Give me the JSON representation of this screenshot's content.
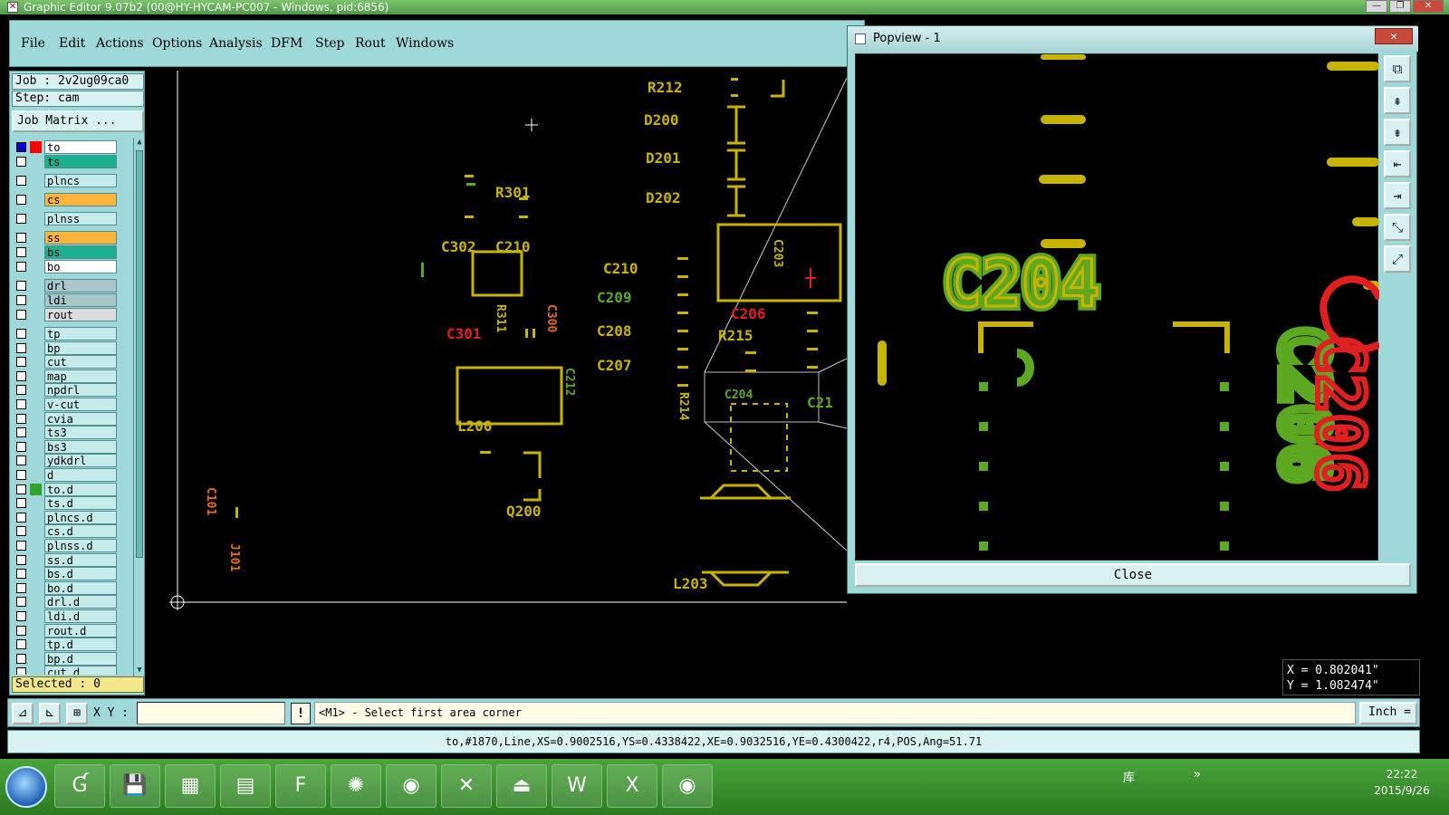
{
  "window": {
    "title": "Graphic Editor 9.07b2 (00@HY-HYCAM-PC007 - Windows, pid:6856)",
    "minimize": "—",
    "restore": "❐",
    "close": "✕"
  },
  "menu": [
    "File",
    "Edit",
    "Actions",
    "Options",
    "Analysis",
    "DFM",
    "Step",
    "Rout",
    "Windows"
  ],
  "job": {
    "job_text": "Job : 2v2ug09ca0",
    "step_text": "Step: cam",
    "matrix_button": "Job Matrix ..."
  },
  "layers": [
    {
      "name": "to",
      "color": "#ffffff",
      "active": true,
      "indicator": "#ff0000"
    },
    {
      "name": "ts",
      "color": "#1db08f"
    },
    {
      "name": "plncs",
      "color": "#c6ebeb"
    },
    {
      "name": "cs",
      "color": "#ffb43c"
    },
    {
      "name": "plnss",
      "color": "#c6ebeb"
    },
    {
      "name": "ss",
      "color": "#ffb43c"
    },
    {
      "name": "bs",
      "color": "#1db08f"
    },
    {
      "name": "bo",
      "color": "#ffffff"
    },
    {
      "name": "drl",
      "color": "#a9c6c9"
    },
    {
      "name": "ldi",
      "color": "#a9c6c9"
    },
    {
      "name": "rout",
      "color": "#dcdcdc"
    },
    {
      "name": "tp",
      "color": "#c6ebeb"
    },
    {
      "name": "bp",
      "color": "#c6ebeb"
    },
    {
      "name": "cut",
      "color": "#c6ebeb"
    },
    {
      "name": "map",
      "color": "#c6ebeb"
    },
    {
      "name": "npdrl",
      "color": "#c6ebeb"
    },
    {
      "name": "v-cut",
      "color": "#c6ebeb"
    },
    {
      "name": "cvia",
      "color": "#c6ebeb"
    },
    {
      "name": "ts3",
      "color": "#c6ebeb"
    },
    {
      "name": "bs3",
      "color": "#c6ebeb"
    },
    {
      "name": "ydkdrl",
      "color": "#c6ebeb"
    },
    {
      "name": "d",
      "color": "#c6ebeb"
    },
    {
      "name": "to.d",
      "color": "#c6ebeb",
      "indicator": "#2fa52f"
    },
    {
      "name": "ts.d",
      "color": "#c6ebeb"
    },
    {
      "name": "plncs.d",
      "color": "#c6ebeb"
    },
    {
      "name": "cs.d",
      "color": "#c6ebeb"
    },
    {
      "name": "plnss.d",
      "color": "#c6ebeb"
    },
    {
      "name": "ss.d",
      "color": "#c6ebeb"
    },
    {
      "name": "bs.d",
      "color": "#c6ebeb"
    },
    {
      "name": "bo.d",
      "color": "#c6ebeb"
    },
    {
      "name": "drl.d",
      "color": "#c6ebeb"
    },
    {
      "name": "ldi.d",
      "color": "#c6ebeb"
    },
    {
      "name": "rout.d",
      "color": "#c6ebeb"
    },
    {
      "name": "tp.d",
      "color": "#c6ebeb"
    },
    {
      "name": "bp.d",
      "color": "#c6ebeb"
    },
    {
      "name": "cut.d",
      "color": "#c6ebeb"
    }
  ],
  "selected_text": "Selected : 0",
  "canvas": {
    "labels": [
      "R212",
      "D200",
      "D201",
      "D202",
      "R301",
      "C302",
      "C210",
      "C210",
      "C209",
      "C208",
      "C207",
      "C301",
      "R311",
      "C300",
      "C212",
      "L200",
      "C203",
      "C206",
      "R215",
      "C204",
      "R214",
      "C21",
      "Q200",
      "L203",
      "C101",
      "J101"
    ]
  },
  "popview": {
    "title": "Popview - 1",
    "close_x": "✕",
    "close_button": "Close",
    "tools": [
      "zoom-fit",
      "page-up",
      "page-down",
      "page-left",
      "page-right",
      "zoom-out",
      "zoom-in"
    ],
    "labels": [
      "C204",
      "C206"
    ]
  },
  "coords": {
    "x_text": "X = 0.802041\"",
    "y_text": "Y = 1.082474\""
  },
  "cmd": {
    "xy_label": "X Y :",
    "xy_value": "",
    "bang": "!",
    "prompt": "<M1> - Select first area corner",
    "units": "Inch ="
  },
  "status_line": "to,#1870,Line,XS=0.9002516,YS=0.4338422,XE=0.9032516,YE=0.4300422,r4,POS,Ang=51.71",
  "taskbar": {
    "tray_text": "库",
    "chevron": "»",
    "time": "22:22",
    "date": "2015/9/26",
    "apps": [
      "genesis-icon",
      "save-icon",
      "calculator-icon",
      "notepad-icon",
      "frontline-icon",
      "shell-icon",
      "eye-icon",
      "x-icon",
      "pdf-icon",
      "word-icon",
      "excel-icon",
      "viewer-icon"
    ],
    "app_glyphs": [
      "Ɠ",
      "💾",
      "▦",
      "▤",
      "F",
      "✺",
      "◉",
      "✕",
      "⏏",
      "W",
      "X",
      "◉"
    ]
  },
  "colors": {
    "pad": "#c8b400",
    "green": "#5ca820",
    "red": "#e02020",
    "panel": "#9fd8d8"
  }
}
